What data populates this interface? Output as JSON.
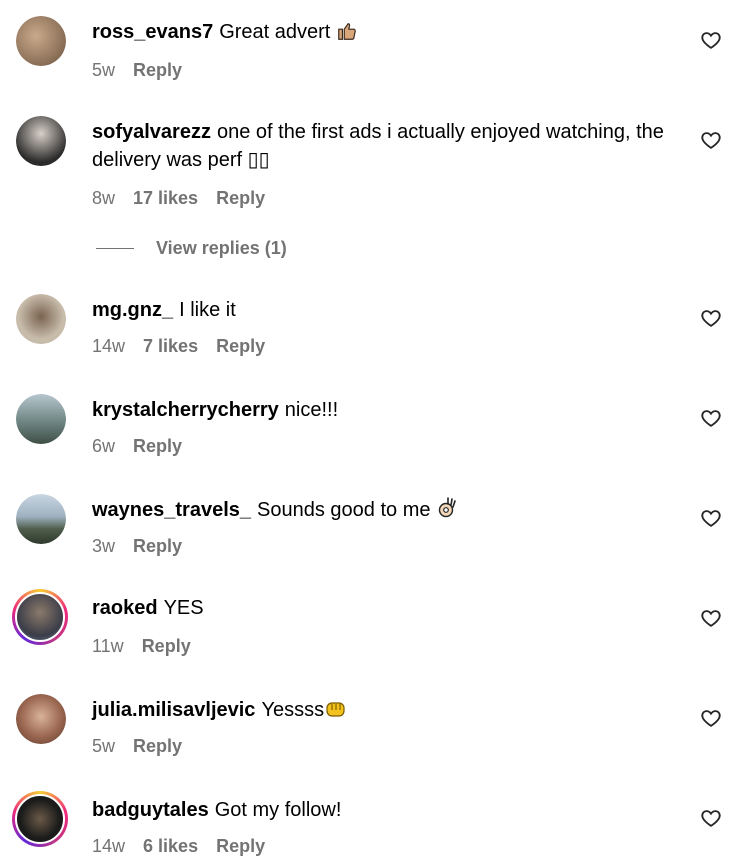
{
  "comments": [
    {
      "username": "ross_evans7",
      "text": "Great advert",
      "emoji": "thumbs-up",
      "age": "5w",
      "likes": "",
      "reply": "Reply",
      "avatar_color": "#8a6a4e",
      "story_ring": false
    },
    {
      "username": "sofyalvarezz",
      "text": "one of the first ads i actually enjoyed watching, the delivery was perf ▯▯",
      "emoji": "",
      "age": "8w",
      "likes": "17 likes",
      "reply": "Reply",
      "avatar_color": "#3d3d3d",
      "story_ring": false
    },
    {
      "username": "mg.gnz_",
      "text": "I like it",
      "emoji": "",
      "age": "14w",
      "likes": "7 likes",
      "reply": "Reply",
      "avatar_color": "#9c8c7a",
      "story_ring": false
    },
    {
      "username": "krystalcherrycherry",
      "text": "nice!!!",
      "emoji": "",
      "age": "6w",
      "likes": "",
      "reply": "Reply",
      "avatar_color": "#5f7b78",
      "story_ring": false
    },
    {
      "username": "waynes_travels_",
      "text": "Sounds good to me",
      "emoji": "ok-hand",
      "age": "3w",
      "likes": "",
      "reply": "Reply",
      "avatar_color": "#7d8fa2",
      "story_ring": false
    },
    {
      "username": "raoked",
      "text": "YES",
      "emoji": "",
      "age": "11w",
      "likes": "",
      "reply": "Reply",
      "avatar_color": "#4a4a52",
      "story_ring": true
    },
    {
      "username": "julia.milisavljevic",
      "text": "Yessss",
      "emoji": "fist",
      "age": "5w",
      "likes": "",
      "reply": "Reply",
      "avatar_color": "#b9826a",
      "story_ring": false
    },
    {
      "username": "badguytales",
      "text": "Got my follow!",
      "emoji": "",
      "age": "14w",
      "likes": "6 likes",
      "reply": "Reply",
      "avatar_color": "#1f1f1f",
      "story_ring": true
    }
  ],
  "view_replies": "View replies (1)",
  "colors": {
    "meta": "#737373",
    "heart": "#262626"
  }
}
